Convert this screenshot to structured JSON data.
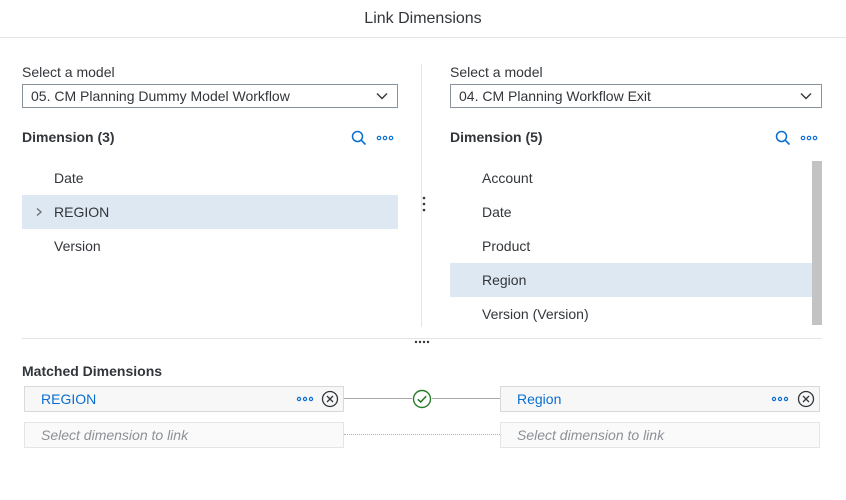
{
  "dialog": {
    "title": "Link Dimensions"
  },
  "left": {
    "select_label": "Select a model",
    "model": "05. CM Planning Dummy Model Workflow",
    "dimension_header": "Dimension  (3)",
    "items": [
      "Date",
      "REGION",
      "Version"
    ],
    "selected_index": 1
  },
  "right": {
    "select_label": "Select a model",
    "model": "04. CM Planning Workflow Exit",
    "dimension_header": "Dimension  (5)",
    "items": [
      "Account",
      "Date",
      "Product",
      "Region",
      "Version (Version)"
    ],
    "selected_index": 3
  },
  "matched": {
    "title": "Matched Dimensions",
    "rows": [
      {
        "left": "REGION",
        "right": "Region",
        "linked": true
      }
    ],
    "placeholder_left": "Select dimension to link",
    "placeholder_right": "Select dimension to link"
  },
  "colors": {
    "accent": "#0a6ed1",
    "selected_bg": "#dee8f2",
    "success": "#2b7d2b"
  },
  "icons": {
    "search": "search-icon",
    "more": "overflow-icon",
    "expand": "chevron-right-icon",
    "dropdown": "chevron-down-icon",
    "remove": "remove-circle-icon",
    "linked": "check-circle-icon"
  }
}
